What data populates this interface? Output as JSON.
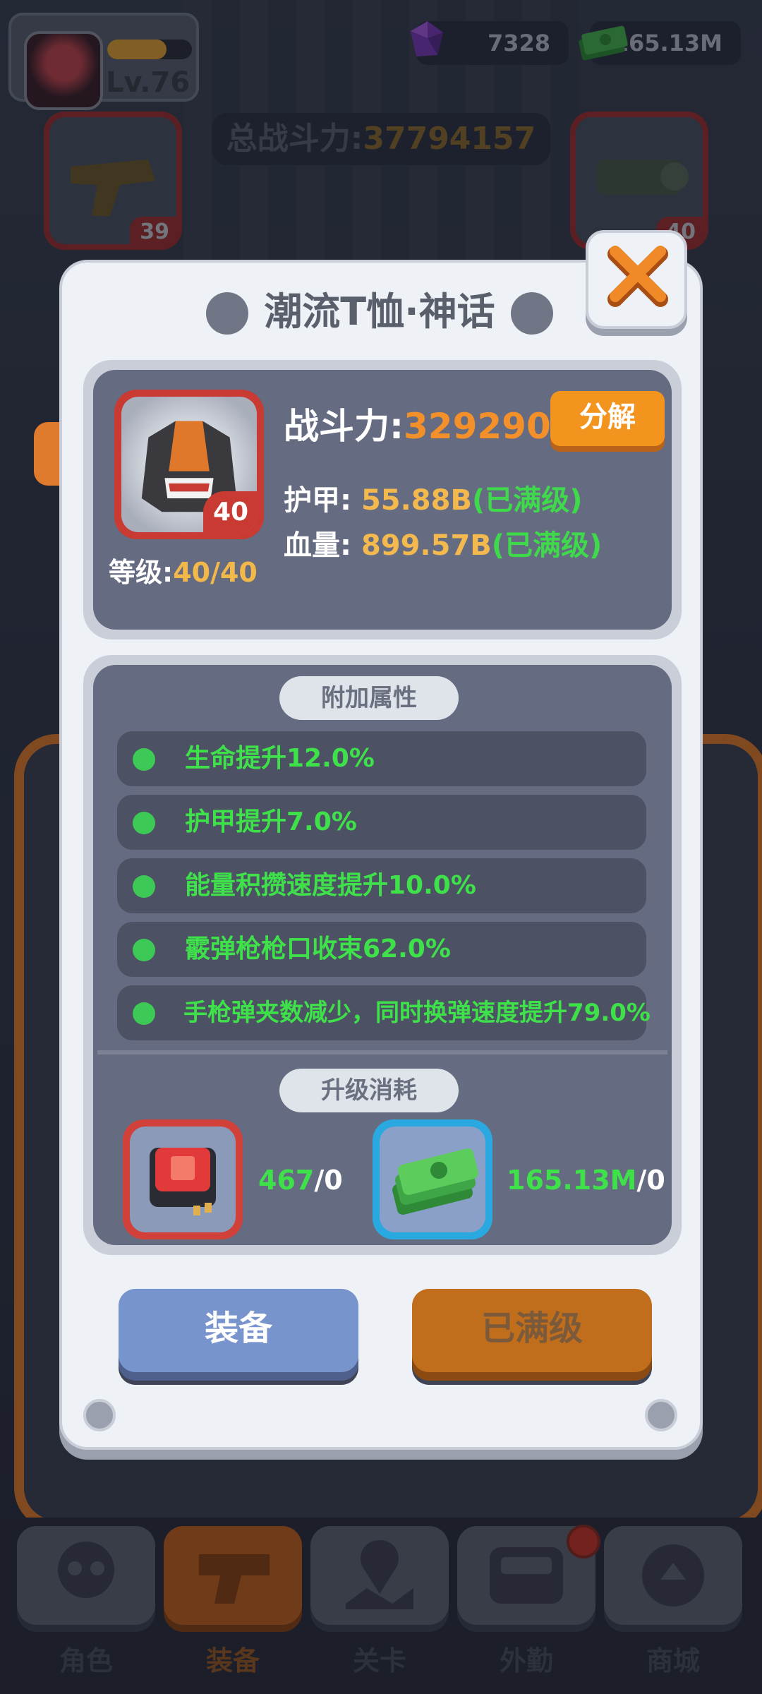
{
  "player": {
    "level": "Lv.76",
    "xp_fraction": 0.7
  },
  "currency": {
    "gems": "7328",
    "cash": "165.13M"
  },
  "total_power": {
    "label": "总战斗力:",
    "value": "37794157"
  },
  "bg_slots": {
    "left_level": "39",
    "right_level": "40"
  },
  "dialog": {
    "title": "潮流T恤·神话",
    "item": {
      "level_badge": "40",
      "grade_label": "等级:",
      "grade_value": "40/40"
    },
    "power_label": "战斗力:",
    "power_value": "329290",
    "decompose_label": "分解",
    "stats": [
      {
        "label": "护甲:",
        "value": "55.88B",
        "max": "(已满级)"
      },
      {
        "label": "血量:",
        "value": "899.57B",
        "max": "(已满级)"
      }
    ],
    "extra_attrs_title": "附加属性",
    "extra_attrs": [
      "生命提升12.0%",
      "护甲提升7.0%",
      "能量积攒速度提升10.0%",
      "霰弹枪枪口收束62.0%",
      "手枪弹夹数减少，同时换弹速度提升79.0%"
    ],
    "upgrade_cost_title": "升级消耗",
    "costs": [
      {
        "icon": "chip-icon",
        "have": "467",
        "need": "/0"
      },
      {
        "icon": "cash-icon",
        "have": "165.13M",
        "need": "/0"
      }
    ],
    "equip_label": "装备",
    "maxed_label": "已满级"
  },
  "nav": [
    {
      "icon": "skull-icon",
      "label": "角色"
    },
    {
      "icon": "gun-icon",
      "label": "装备"
    },
    {
      "icon": "map-pin-icon",
      "label": "关卡"
    },
    {
      "icon": "console-icon",
      "label": "外勤"
    },
    {
      "icon": "shop-icon",
      "label": "商城"
    }
  ],
  "colors": {
    "accent": "#f3941e",
    "mythic_frame": "#c83a32",
    "attr_green": "#3fe14a",
    "gold": "#f3b94e"
  }
}
